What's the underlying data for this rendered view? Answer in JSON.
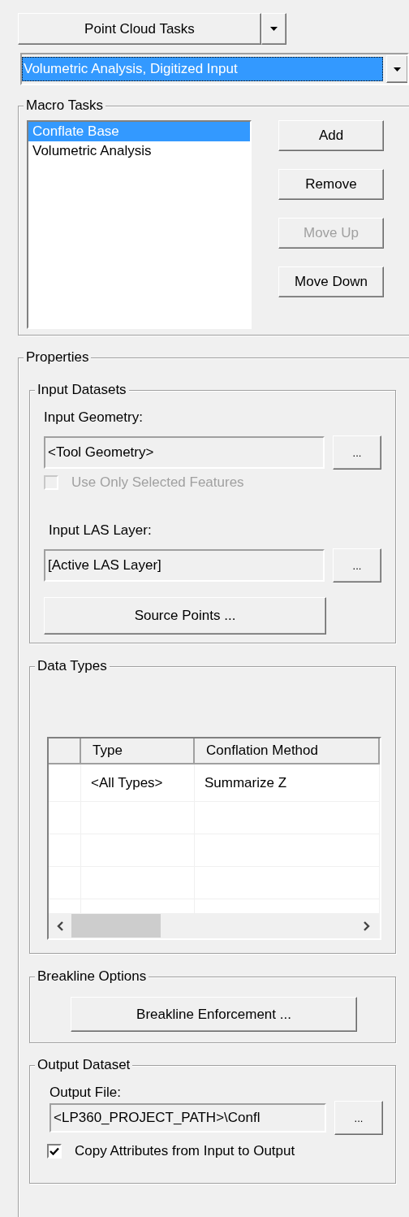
{
  "task_menu": {
    "label": "Point Cloud Tasks"
  },
  "macro_selector": {
    "value": "Volumetric Analysis, Digitized Input"
  },
  "macro_tasks": {
    "title": "Macro Tasks",
    "items": [
      {
        "label": "Conflate Base",
        "selected": true
      },
      {
        "label": "Volumetric Analysis",
        "selected": false
      }
    ],
    "buttons": [
      {
        "label": "Add",
        "disabled": false
      },
      {
        "label": "Remove",
        "disabled": false
      },
      {
        "label": "Move Up",
        "disabled": true
      },
      {
        "label": "Move Down",
        "disabled": false
      }
    ]
  },
  "properties": {
    "title": "Properties",
    "input_datasets": {
      "title": "Input Datasets",
      "geometry_label": "Input Geometry:",
      "geometry_value": "<Tool Geometry>",
      "geometry_browse": "...",
      "use_selected": {
        "label": "Use Only Selected Features",
        "checked": false,
        "disabled": true
      },
      "las_label": "Input LAS Layer:",
      "las_value": "[Active LAS Layer]",
      "las_browse": "...",
      "source_points_button": "Source Points ..."
    },
    "data_types": {
      "title": "Data Types",
      "columns": [
        "Type",
        "Conflation Method"
      ],
      "rows": [
        [
          "<All Types>",
          "Summarize Z"
        ]
      ]
    },
    "breakline_options": {
      "title": "Breakline Options",
      "button": "Breakline Enforcement ..."
    },
    "output_dataset": {
      "title": "Output Dataset",
      "file_label": "Output File:",
      "file_value": "<LP360_PROJECT_PATH>\\Confl",
      "file_browse": "...",
      "copy_attributes": {
        "label": "Copy Attributes from Input to Output",
        "checked": true,
        "disabled": false
      }
    }
  }
}
